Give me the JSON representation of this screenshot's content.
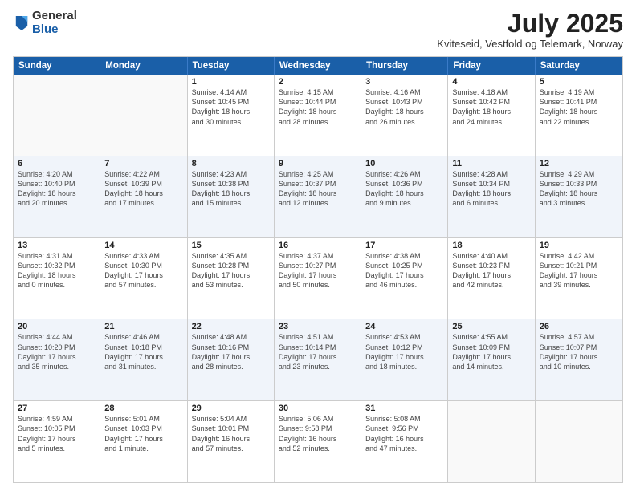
{
  "logo": {
    "general": "General",
    "blue": "Blue"
  },
  "title": "July 2025",
  "subtitle": "Kviteseid, Vestfold og Telemark, Norway",
  "header_days": [
    "Sunday",
    "Monday",
    "Tuesday",
    "Wednesday",
    "Thursday",
    "Friday",
    "Saturday"
  ],
  "rows": [
    [
      {
        "day": "",
        "lines": [],
        "empty": true
      },
      {
        "day": "",
        "lines": [],
        "empty": true
      },
      {
        "day": "1",
        "lines": [
          "Sunrise: 4:14 AM",
          "Sunset: 10:45 PM",
          "Daylight: 18 hours",
          "and 30 minutes."
        ]
      },
      {
        "day": "2",
        "lines": [
          "Sunrise: 4:15 AM",
          "Sunset: 10:44 PM",
          "Daylight: 18 hours",
          "and 28 minutes."
        ]
      },
      {
        "day": "3",
        "lines": [
          "Sunrise: 4:16 AM",
          "Sunset: 10:43 PM",
          "Daylight: 18 hours",
          "and 26 minutes."
        ]
      },
      {
        "day": "4",
        "lines": [
          "Sunrise: 4:18 AM",
          "Sunset: 10:42 PM",
          "Daylight: 18 hours",
          "and 24 minutes."
        ]
      },
      {
        "day": "5",
        "lines": [
          "Sunrise: 4:19 AM",
          "Sunset: 10:41 PM",
          "Daylight: 18 hours",
          "and 22 minutes."
        ]
      }
    ],
    [
      {
        "day": "6",
        "lines": [
          "Sunrise: 4:20 AM",
          "Sunset: 10:40 PM",
          "Daylight: 18 hours",
          "and 20 minutes."
        ]
      },
      {
        "day": "7",
        "lines": [
          "Sunrise: 4:22 AM",
          "Sunset: 10:39 PM",
          "Daylight: 18 hours",
          "and 17 minutes."
        ]
      },
      {
        "day": "8",
        "lines": [
          "Sunrise: 4:23 AM",
          "Sunset: 10:38 PM",
          "Daylight: 18 hours",
          "and 15 minutes."
        ]
      },
      {
        "day": "9",
        "lines": [
          "Sunrise: 4:25 AM",
          "Sunset: 10:37 PM",
          "Daylight: 18 hours",
          "and 12 minutes."
        ]
      },
      {
        "day": "10",
        "lines": [
          "Sunrise: 4:26 AM",
          "Sunset: 10:36 PM",
          "Daylight: 18 hours",
          "and 9 minutes."
        ]
      },
      {
        "day": "11",
        "lines": [
          "Sunrise: 4:28 AM",
          "Sunset: 10:34 PM",
          "Daylight: 18 hours",
          "and 6 minutes."
        ]
      },
      {
        "day": "12",
        "lines": [
          "Sunrise: 4:29 AM",
          "Sunset: 10:33 PM",
          "Daylight: 18 hours",
          "and 3 minutes."
        ]
      }
    ],
    [
      {
        "day": "13",
        "lines": [
          "Sunrise: 4:31 AM",
          "Sunset: 10:32 PM",
          "Daylight: 18 hours",
          "and 0 minutes."
        ]
      },
      {
        "day": "14",
        "lines": [
          "Sunrise: 4:33 AM",
          "Sunset: 10:30 PM",
          "Daylight: 17 hours",
          "and 57 minutes."
        ]
      },
      {
        "day": "15",
        "lines": [
          "Sunrise: 4:35 AM",
          "Sunset: 10:28 PM",
          "Daylight: 17 hours",
          "and 53 minutes."
        ]
      },
      {
        "day": "16",
        "lines": [
          "Sunrise: 4:37 AM",
          "Sunset: 10:27 PM",
          "Daylight: 17 hours",
          "and 50 minutes."
        ]
      },
      {
        "day": "17",
        "lines": [
          "Sunrise: 4:38 AM",
          "Sunset: 10:25 PM",
          "Daylight: 17 hours",
          "and 46 minutes."
        ]
      },
      {
        "day": "18",
        "lines": [
          "Sunrise: 4:40 AM",
          "Sunset: 10:23 PM",
          "Daylight: 17 hours",
          "and 42 minutes."
        ]
      },
      {
        "day": "19",
        "lines": [
          "Sunrise: 4:42 AM",
          "Sunset: 10:21 PM",
          "Daylight: 17 hours",
          "and 39 minutes."
        ]
      }
    ],
    [
      {
        "day": "20",
        "lines": [
          "Sunrise: 4:44 AM",
          "Sunset: 10:20 PM",
          "Daylight: 17 hours",
          "and 35 minutes."
        ]
      },
      {
        "day": "21",
        "lines": [
          "Sunrise: 4:46 AM",
          "Sunset: 10:18 PM",
          "Daylight: 17 hours",
          "and 31 minutes."
        ]
      },
      {
        "day": "22",
        "lines": [
          "Sunrise: 4:48 AM",
          "Sunset: 10:16 PM",
          "Daylight: 17 hours",
          "and 28 minutes."
        ]
      },
      {
        "day": "23",
        "lines": [
          "Sunrise: 4:51 AM",
          "Sunset: 10:14 PM",
          "Daylight: 17 hours",
          "and 23 minutes."
        ]
      },
      {
        "day": "24",
        "lines": [
          "Sunrise: 4:53 AM",
          "Sunset: 10:12 PM",
          "Daylight: 17 hours",
          "and 18 minutes."
        ]
      },
      {
        "day": "25",
        "lines": [
          "Sunrise: 4:55 AM",
          "Sunset: 10:09 PM",
          "Daylight: 17 hours",
          "and 14 minutes."
        ]
      },
      {
        "day": "26",
        "lines": [
          "Sunrise: 4:57 AM",
          "Sunset: 10:07 PM",
          "Daylight: 17 hours",
          "and 10 minutes."
        ]
      }
    ],
    [
      {
        "day": "27",
        "lines": [
          "Sunrise: 4:59 AM",
          "Sunset: 10:05 PM",
          "Daylight: 17 hours",
          "and 5 minutes."
        ]
      },
      {
        "day": "28",
        "lines": [
          "Sunrise: 5:01 AM",
          "Sunset: 10:03 PM",
          "Daylight: 17 hours",
          "and 1 minute."
        ]
      },
      {
        "day": "29",
        "lines": [
          "Sunrise: 5:04 AM",
          "Sunset: 10:01 PM",
          "Daylight: 16 hours",
          "and 57 minutes."
        ]
      },
      {
        "day": "30",
        "lines": [
          "Sunrise: 5:06 AM",
          "Sunset: 9:58 PM",
          "Daylight: 16 hours",
          "and 52 minutes."
        ]
      },
      {
        "day": "31",
        "lines": [
          "Sunrise: 5:08 AM",
          "Sunset: 9:56 PM",
          "Daylight: 16 hours",
          "and 47 minutes."
        ]
      },
      {
        "day": "",
        "lines": [],
        "empty": true
      },
      {
        "day": "",
        "lines": [],
        "empty": true
      }
    ]
  ]
}
